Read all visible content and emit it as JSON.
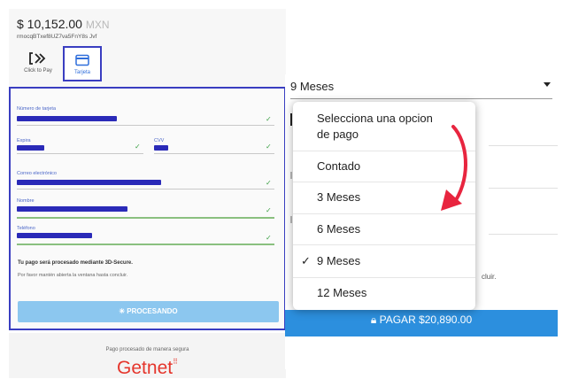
{
  "checkout": {
    "amount": "$ 10,152.00",
    "currency": "MXN",
    "reference": "rmocqBTxef8UZ7va5FnY8s Jvf",
    "methods": [
      {
        "label": "Click to Pay"
      },
      {
        "label": "Tarjeta"
      }
    ],
    "fields": {
      "card_number": {
        "label": "Número de tarjeta"
      },
      "expiry": {
        "label": "Expira"
      },
      "cvv": {
        "label": "CVV"
      },
      "email": {
        "label": "Correo electrónico"
      },
      "name": {
        "label": "Nombre"
      },
      "phone": {
        "label": "Teléfono"
      }
    },
    "secure_title": "Tu pago será procesado mediante 3D-Secure.",
    "secure_sub": "Por favor mantén abierta la ventana hasta concluir.",
    "processing_label": "PROCESANDO",
    "footer_text": "Pago procesado de manera segura",
    "brand": "Getnet"
  },
  "installments": {
    "selected": "9 Meses",
    "options": [
      {
        "label": "Selecciona una opcion de pago",
        "line1": "Selecciona una opcion",
        "line2": "de pago",
        "checked": false
      },
      {
        "label": "Contado",
        "checked": false
      },
      {
        "label": "3 Meses",
        "checked": false
      },
      {
        "label": "6 Meses",
        "checked": false
      },
      {
        "label": "9 Meses",
        "checked": true
      },
      {
        "label": "12 Meses",
        "checked": false
      }
    ],
    "check_glyph": "✓",
    "background_text": "cluir.",
    "pay_button": "PAGAR $20,890.00"
  },
  "colors": {
    "highlight_border": "#3a3ec1",
    "arrow": "#e8253f",
    "pay_button": "#2c8fde",
    "processing_button": "#8cc7ef",
    "brand": "#e5362c"
  },
  "icons": [
    "click-to-pay-icon",
    "card-icon",
    "check-icon",
    "spinner-icon",
    "lock-icon",
    "caret-down-icon",
    "arrow-annotation"
  ]
}
